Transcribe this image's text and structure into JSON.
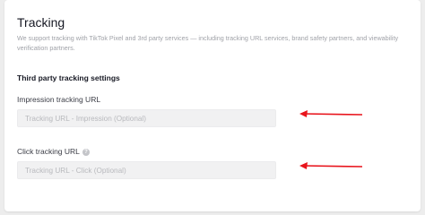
{
  "section": {
    "title": "Tracking",
    "description": "We support tracking with TikTok Pixel and 3rd party services — including tracking URL services, brand safety partners, and viewability verification partners."
  },
  "third_party": {
    "heading": "Third party tracking settings",
    "impression": {
      "label": "Impression tracking URL",
      "placeholder": "Tracking URL - Impression (Optional)",
      "value": ""
    },
    "click": {
      "label": "Click tracking URL",
      "placeholder": "Tracking URL - Click (Optional)",
      "value": "",
      "help_icon": "question-circle-icon"
    }
  },
  "annotations": {
    "arrow_color": "#e8141c",
    "arrow_icon": "red-arrow-left-icon"
  }
}
